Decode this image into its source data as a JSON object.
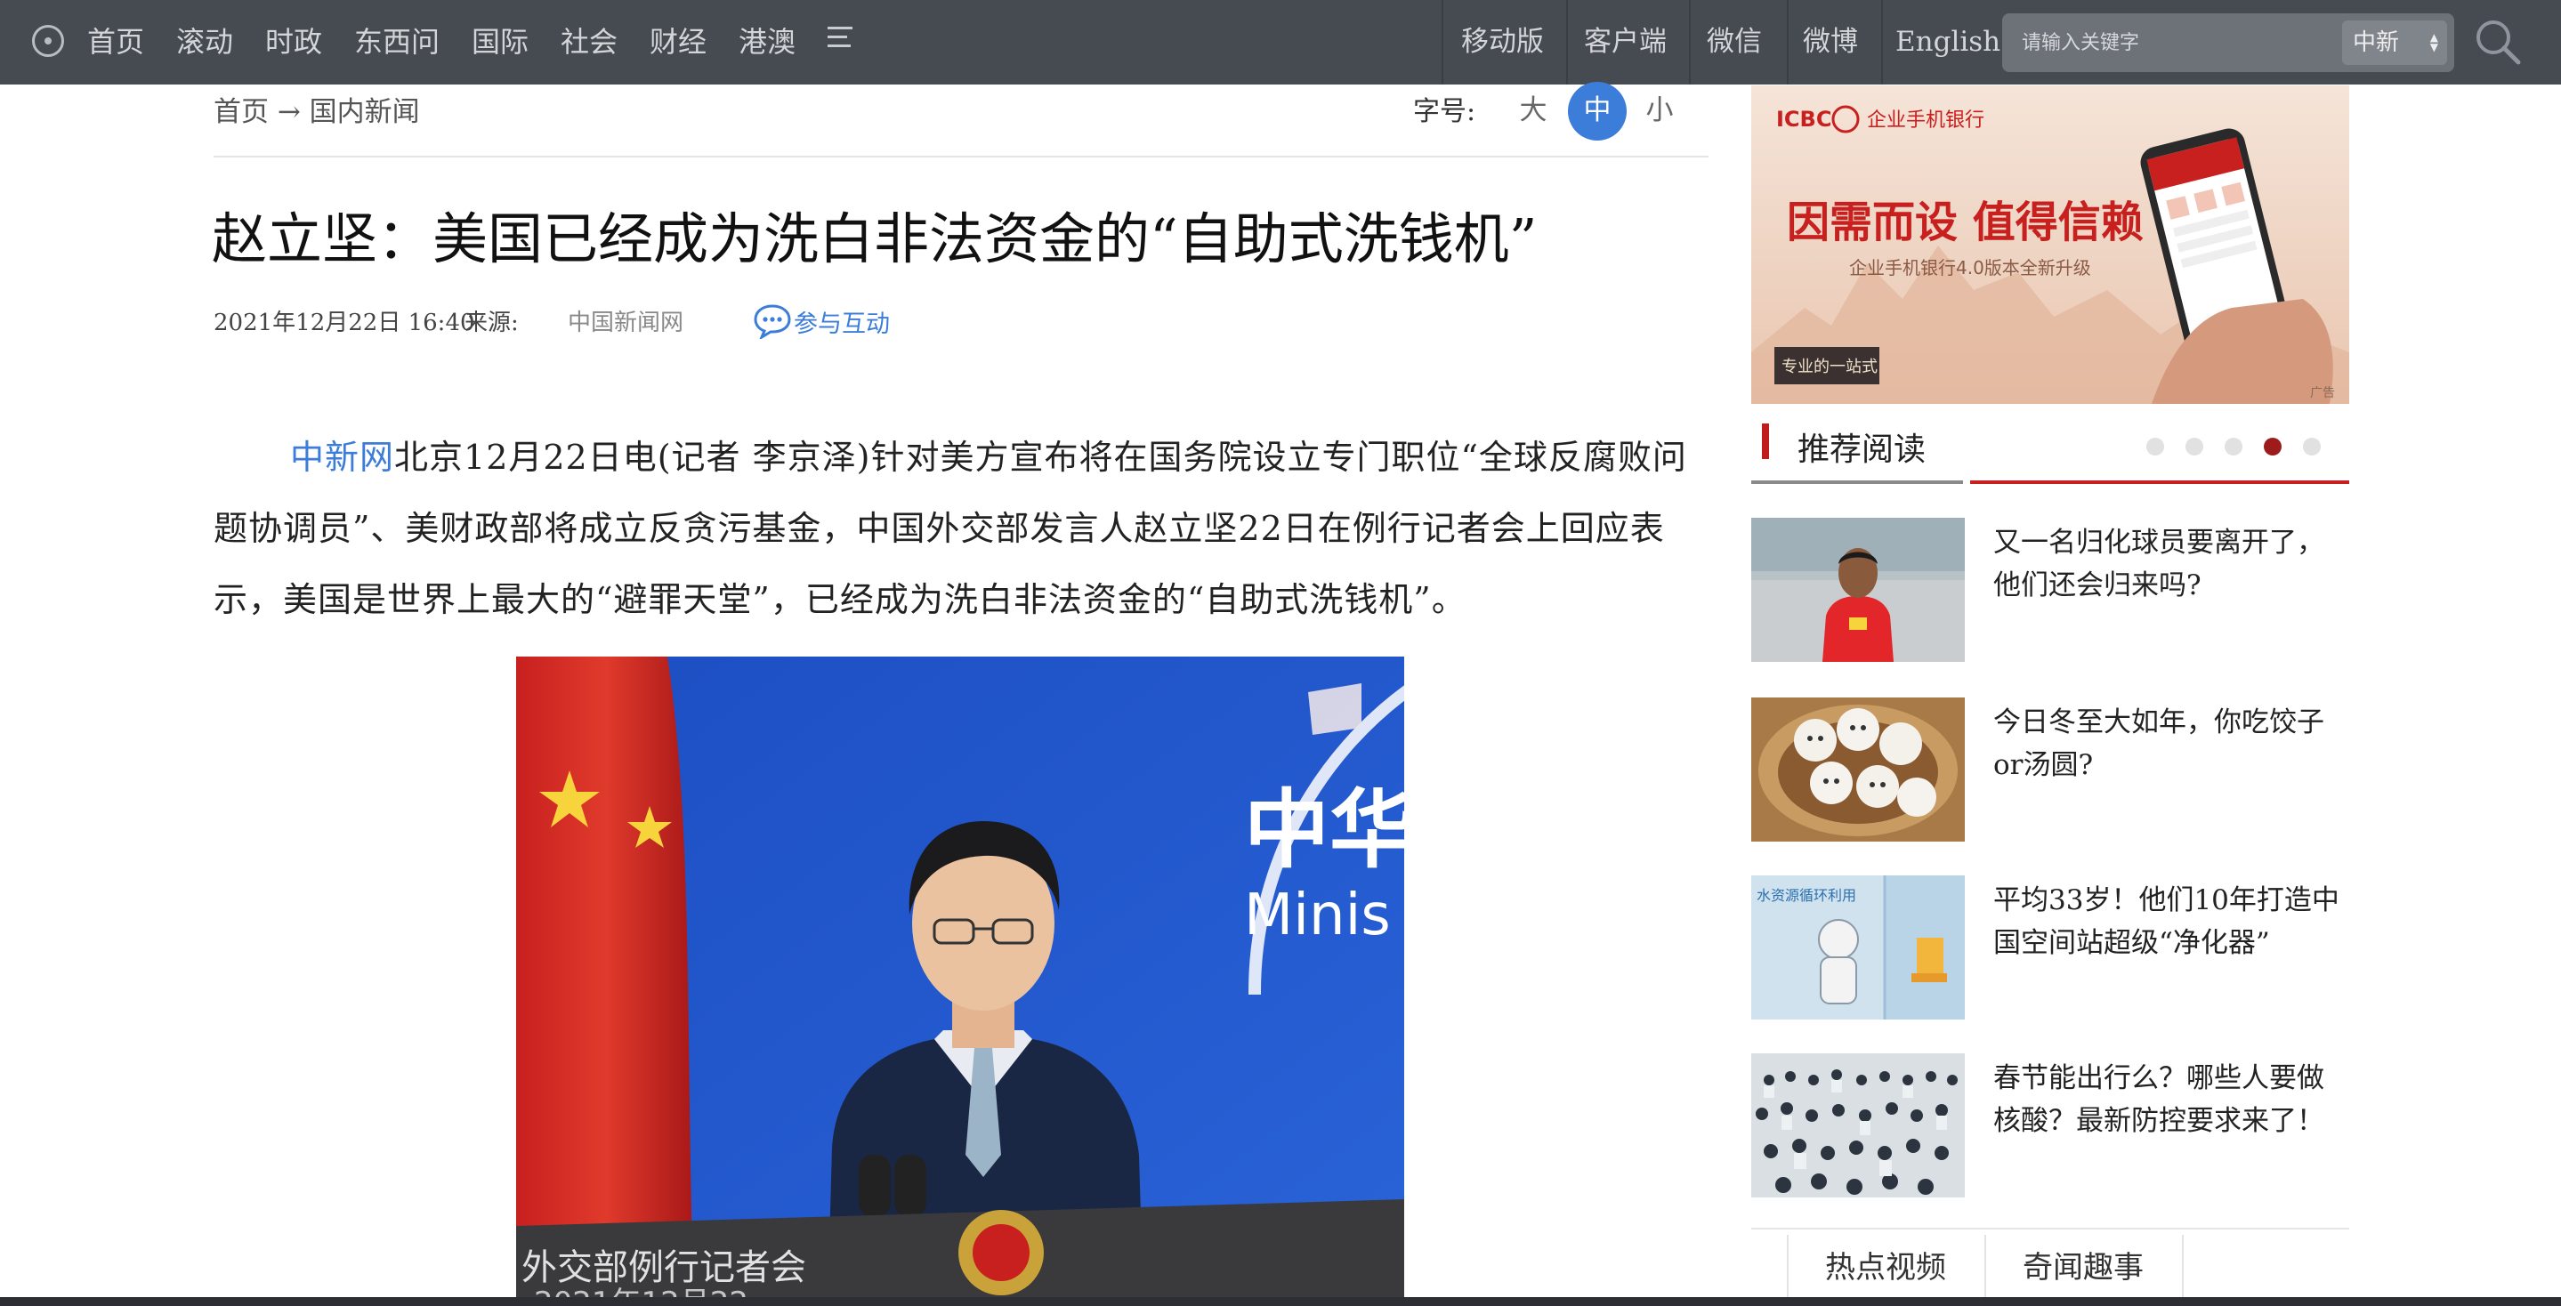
{
  "nav": {
    "items": [
      "首页",
      "滚动",
      "时政",
      "东西问",
      "国际",
      "社会",
      "财经",
      "港澳"
    ],
    "right_links": [
      "移动版",
      "客户端",
      "微信",
      "微博",
      "English"
    ]
  },
  "search": {
    "placeholder": "请输入关键字",
    "site_selected": "中新"
  },
  "breadcrumb": "首页 → 国内新闻",
  "font_size": {
    "label": "字号:",
    "options": [
      "大",
      "中",
      "小"
    ],
    "active": "中"
  },
  "article": {
    "title": "赵立坚：美国已经成为洗白非法资金的“自助式洗钱机”",
    "date": "2021年12月22日 16:40",
    "source_label": "来源:",
    "source": "中国新闻网",
    "interact_label": "参与互动",
    "lead_source": "中新网",
    "lead_text": "北京12月22日电(记者 李京泽)针对美方宣布将在国务院设立专门职位“全球反腐败问题协调员”、美财政部将成立反贪污基金，中国外交部发言人赵立坚22日在例行记者会上回应表示，美国是世界上最大的“避罪天堂”，已经成为洗白非法资金的“自助式洗钱机”。",
    "photo_caption_partial": "外交部例行记者会",
    "photo_sign_text": "中华",
    "photo_sign_text_en": "Minis",
    "photo_caption_date_partial": "2021年12月22"
  },
  "ad": {
    "bank": "ICBC",
    "bank_name": "企业手机银行",
    "headline": "因需而设 值得信赖",
    "subline": "企业手机银行4.0版本全新升级",
    "badge": "专业的一站式",
    "corner_tag": "广告"
  },
  "recommend": {
    "title": "推荐阅读",
    "dots": 5,
    "active_dot": 4,
    "items": [
      {
        "text": "又一名归化球员要离开了，他们还会归来吗?"
      },
      {
        "text": "今日冬至大如年，你吃饺子or汤圆?"
      },
      {
        "text": "平均33岁！他们10年打造中国空间站超级“净化器”",
        "thumb_text": "水资源循环利用"
      },
      {
        "text": "春节能出行么？哪些人要做核酸？最新防控要求来了！"
      }
    ]
  },
  "bottom_tabs": [
    "热点视频",
    "奇闻趣事"
  ],
  "colors": {
    "nav_bg": "#464b52",
    "accent_blue": "#3b7dd8",
    "accent_red": "#c81f1f"
  }
}
